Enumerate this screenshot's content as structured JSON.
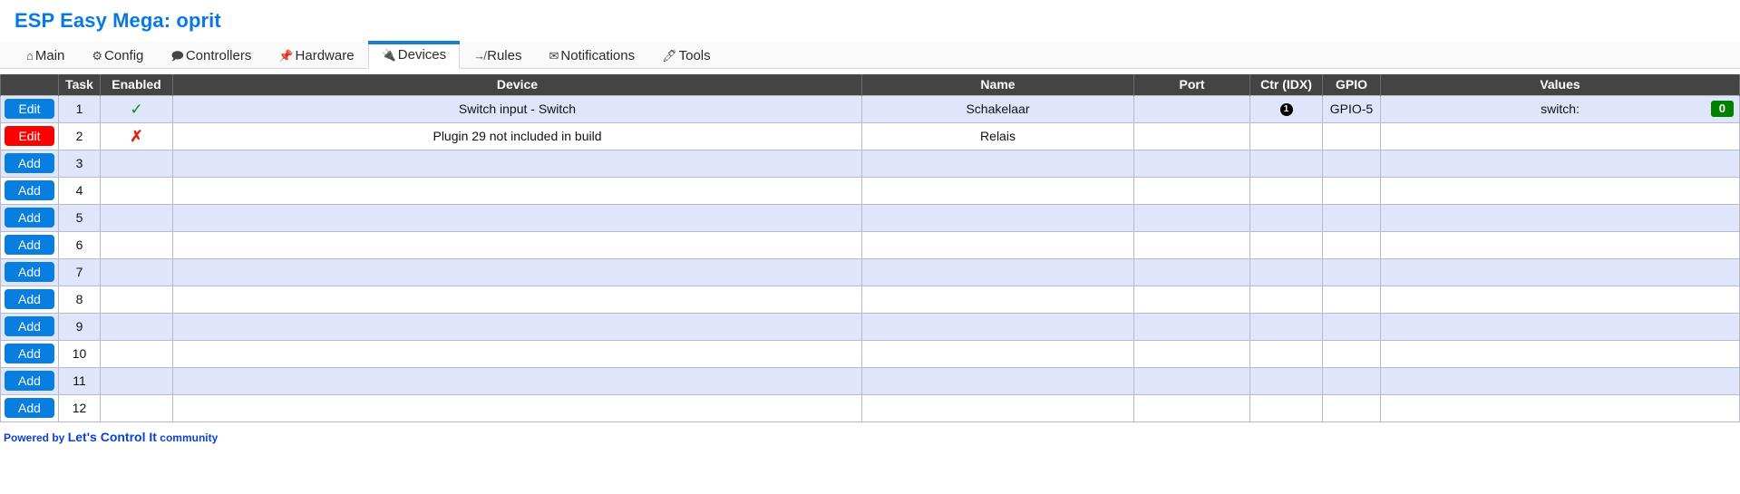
{
  "header": {
    "title": "ESP Easy Mega: oprit"
  },
  "nav": {
    "tabs": [
      {
        "label": "Main",
        "icon": "home-icon",
        "glyph": "⌂",
        "active": false
      },
      {
        "label": "Config",
        "icon": "gear-icon",
        "glyph": "⚙",
        "active": false
      },
      {
        "label": "Controllers",
        "icon": "chat-icon",
        "glyph": "🗩",
        "active": false
      },
      {
        "label": "Hardware",
        "icon": "pushpin-icon",
        "glyph": "📌",
        "active": false
      },
      {
        "label": "Devices",
        "icon": "plug-icon",
        "glyph": "🔌",
        "active": true
      },
      {
        "label": "Rules",
        "icon": "arrow-branch-icon",
        "glyph": "↛",
        "active": false
      },
      {
        "label": "Notifications",
        "icon": "envelope-icon",
        "glyph": "✉",
        "active": false
      },
      {
        "label": "Tools",
        "icon": "wrench-icon",
        "glyph": "🖊",
        "active": false
      }
    ]
  },
  "table": {
    "columns": [
      "",
      "Task",
      "Enabled",
      "Device",
      "Name",
      "Port",
      "Ctr (IDX)",
      "GPIO",
      "Values"
    ],
    "rows": [
      {
        "action": "Edit",
        "action_style": "edit-blue",
        "task": "1",
        "enabled": "✓",
        "enabled_state": "enabled",
        "device": "Switch input - Switch",
        "name": "Schakelaar",
        "port": "",
        "ctr": "1",
        "ctr_style": "circled",
        "gpio": "GPIO-5",
        "value_label": "switch:",
        "value_badge": "0",
        "badge_color": "#008000"
      },
      {
        "action": "Edit",
        "action_style": "edit-red",
        "task": "2",
        "enabled": "✗",
        "enabled_state": "disabled",
        "device": "Plugin 29 not included in build",
        "name": "Relais",
        "port": "",
        "ctr": "",
        "ctr_style": "plain",
        "gpio": "",
        "value_label": "",
        "value_badge": "",
        "badge_color": ""
      },
      {
        "action": "Add",
        "action_style": "add",
        "task": "3",
        "enabled": "",
        "enabled_state": "",
        "device": "",
        "name": "",
        "port": "",
        "ctr": "",
        "ctr_style": "plain",
        "gpio": "",
        "value_label": "",
        "value_badge": "",
        "badge_color": ""
      },
      {
        "action": "Add",
        "action_style": "add",
        "task": "4",
        "enabled": "",
        "enabled_state": "",
        "device": "",
        "name": "",
        "port": "",
        "ctr": "",
        "ctr_style": "plain",
        "gpio": "",
        "value_label": "",
        "value_badge": "",
        "badge_color": ""
      },
      {
        "action": "Add",
        "action_style": "add",
        "task": "5",
        "enabled": "",
        "enabled_state": "",
        "device": "",
        "name": "",
        "port": "",
        "ctr": "",
        "ctr_style": "plain",
        "gpio": "",
        "value_label": "",
        "value_badge": "",
        "badge_color": ""
      },
      {
        "action": "Add",
        "action_style": "add",
        "task": "6",
        "enabled": "",
        "enabled_state": "",
        "device": "",
        "name": "",
        "port": "",
        "ctr": "",
        "ctr_style": "plain",
        "gpio": "",
        "value_label": "",
        "value_badge": "",
        "badge_color": ""
      },
      {
        "action": "Add",
        "action_style": "add",
        "task": "7",
        "enabled": "",
        "enabled_state": "",
        "device": "",
        "name": "",
        "port": "",
        "ctr": "",
        "ctr_style": "plain",
        "gpio": "",
        "value_label": "",
        "value_badge": "",
        "badge_color": ""
      },
      {
        "action": "Add",
        "action_style": "add",
        "task": "8",
        "enabled": "",
        "enabled_state": "",
        "device": "",
        "name": "",
        "port": "",
        "ctr": "",
        "ctr_style": "plain",
        "gpio": "",
        "value_label": "",
        "value_badge": "",
        "badge_color": ""
      },
      {
        "action": "Add",
        "action_style": "add",
        "task": "9",
        "enabled": "",
        "enabled_state": "",
        "device": "",
        "name": "",
        "port": "",
        "ctr": "",
        "ctr_style": "plain",
        "gpio": "",
        "value_label": "",
        "value_badge": "",
        "badge_color": ""
      },
      {
        "action": "Add",
        "action_style": "add",
        "task": "10",
        "enabled": "",
        "enabled_state": "",
        "device": "",
        "name": "",
        "port": "",
        "ctr": "",
        "ctr_style": "plain",
        "gpio": "",
        "value_label": "",
        "value_badge": "",
        "badge_color": ""
      },
      {
        "action": "Add",
        "action_style": "add",
        "task": "11",
        "enabled": "",
        "enabled_state": "",
        "device": "",
        "name": "",
        "port": "",
        "ctr": "",
        "ctr_style": "plain",
        "gpio": "",
        "value_label": "",
        "value_badge": "",
        "badge_color": ""
      },
      {
        "action": "Add",
        "action_style": "add",
        "task": "12",
        "enabled": "",
        "enabled_state": "",
        "device": "",
        "name": "",
        "port": "",
        "ctr": "",
        "ctr_style": "plain",
        "gpio": "",
        "value_label": "",
        "value_badge": "",
        "badge_color": ""
      }
    ]
  },
  "footer": {
    "prefix": "Powered by",
    "brand": "Let's Control It",
    "suffix": "community"
  },
  "colors": {
    "accent": "#0779e4",
    "button_blue": "#077ee0",
    "button_red": "#fb0000",
    "header_bg": "#444444",
    "row_odd": "#dfe5fb",
    "badge_green": "#008000",
    "check_green": "#128a12",
    "cross_red": "#d8261a"
  }
}
